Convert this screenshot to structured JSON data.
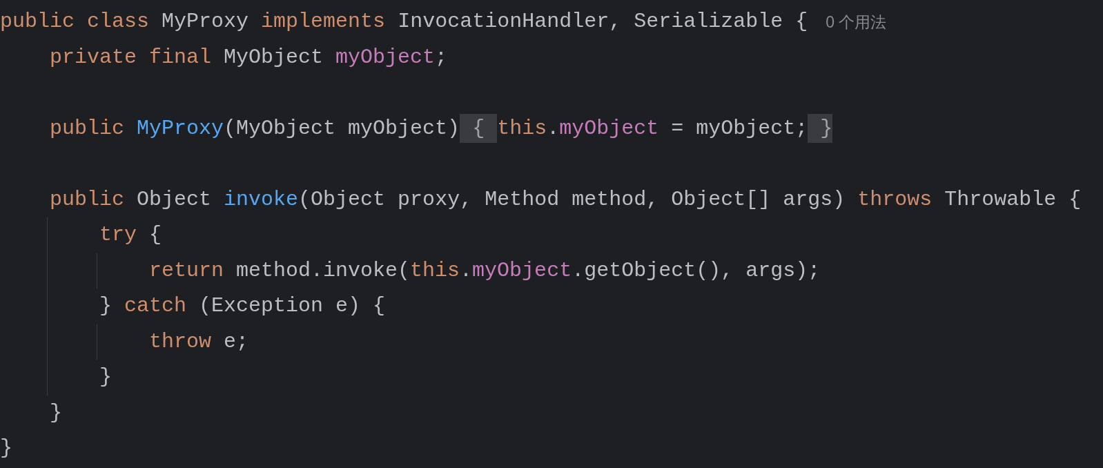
{
  "editor": {
    "lines": [
      {
        "tokens": [
          {
            "kind": "keyword",
            "text": "public class "
          },
          {
            "kind": "text",
            "text": "MyProxy "
          },
          {
            "kind": "keyword",
            "text": "implements "
          },
          {
            "kind": "text",
            "text": "InvocationHandler, Serializable {"
          },
          {
            "kind": "hint",
            "text": "0 个用法"
          }
        ],
        "children": [
          {
            "tokens": [
              {
                "kind": "keyword",
                "text": "private final "
              },
              {
                "kind": "text",
                "text": "MyObject "
              },
              {
                "kind": "field",
                "text": "myObject"
              },
              {
                "kind": "text",
                "text": ";"
              }
            ]
          },
          {
            "kind": "blank"
          },
          {
            "tokens": [
              {
                "kind": "keyword",
                "text": "public "
              },
              {
                "kind": "method",
                "text": "MyProxy"
              },
              {
                "kind": "text",
                "text": "(MyObject myObject)"
              },
              {
                "kind": "fold",
                "text": " { "
              },
              {
                "kind": "keyword",
                "text": "this"
              },
              {
                "kind": "text",
                "text": "."
              },
              {
                "kind": "field",
                "text": "myObject"
              },
              {
                "kind": "text",
                "text": " = myObject;"
              },
              {
                "kind": "fold",
                "text": " }"
              }
            ]
          },
          {
            "kind": "blank"
          },
          {
            "tokens": [
              {
                "kind": "keyword",
                "text": "public "
              },
              {
                "kind": "text",
                "text": "Object "
              },
              {
                "kind": "method",
                "text": "invoke"
              },
              {
                "kind": "text",
                "text": "(Object proxy, Method method, Object[] args) "
              },
              {
                "kind": "keyword",
                "text": "throws "
              },
              {
                "kind": "text",
                "text": "Throwable {"
              }
            ],
            "children": [
              {
                "tokens": [
                  {
                    "kind": "keyword",
                    "text": "try "
                  },
                  {
                    "kind": "text",
                    "text": "{"
                  }
                ],
                "children": [
                  {
                    "tokens": [
                      {
                        "kind": "keyword",
                        "text": "return "
                      },
                      {
                        "kind": "text",
                        "text": "method.invoke("
                      },
                      {
                        "kind": "keyword",
                        "text": "this"
                      },
                      {
                        "kind": "text",
                        "text": "."
                      },
                      {
                        "kind": "field",
                        "text": "myObject"
                      },
                      {
                        "kind": "text",
                        "text": ".getObject(), args);"
                      }
                    ]
                  }
                ]
              },
              {
                "tokens": [
                  {
                    "kind": "text",
                    "text": "} "
                  },
                  {
                    "kind": "keyword",
                    "text": "catch "
                  },
                  {
                    "kind": "text",
                    "text": "(Exception e) {"
                  }
                ],
                "children": [
                  {
                    "tokens": [
                      {
                        "kind": "keyword",
                        "text": "throw "
                      },
                      {
                        "kind": "text",
                        "text": "e;"
                      }
                    ]
                  }
                ]
              },
              {
                "tokens": [
                  {
                    "kind": "text",
                    "text": "}"
                  }
                ]
              }
            ]
          },
          {
            "tokens": [
              {
                "kind": "text",
                "text": "}"
              }
            ]
          }
        ]
      },
      {
        "tokens": [
          {
            "kind": "text",
            "text": "}"
          }
        ]
      }
    ]
  }
}
